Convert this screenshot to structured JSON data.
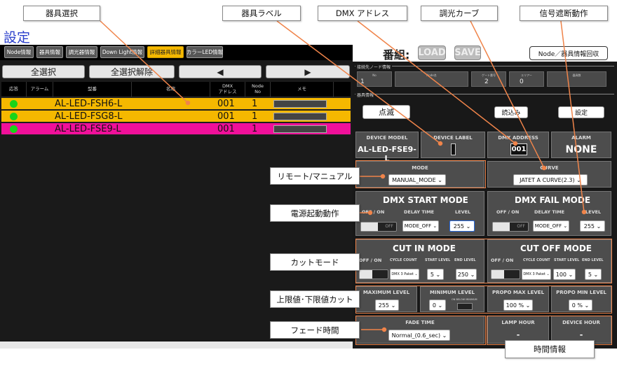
{
  "page_title": "設定",
  "tabs": [
    "Node情報",
    "器具情報",
    "調光器情報",
    "Down Light情報",
    "詳細器具情報",
    "カラーLED情報"
  ],
  "active_tab": "詳細器具情報",
  "left_toolbar": {
    "select_all": "全選択",
    "deselect_all": "全選択解除",
    "prev": "◀",
    "next": "▶"
  },
  "table": {
    "headers": [
      "応答",
      "アラーム",
      "型番",
      "名称",
      "DMX\nアドレス",
      "Node\nNo",
      "メモ"
    ],
    "rows": [
      {
        "model": "AL-LED-FSH6-L",
        "dmx": "001",
        "node": "1",
        "bg": "#f5b800"
      },
      {
        "model": "AL-LED-FSG8-L",
        "dmx": "001",
        "node": "1",
        "bg": "#f5b800"
      },
      {
        "model": "AL-LED-FSE9-L",
        "dmx": "001",
        "node": "1",
        "bg": "#f0109a"
      }
    ]
  },
  "program": {
    "label": "番組:",
    "load": "LOAD",
    "save": "SAVE",
    "node_collect": "Node／器具情報回収"
  },
  "conn_node": {
    "title": "接続先ノード情報",
    "fields": [
      {
        "label": "No",
        "value": "1"
      },
      {
        "label": "Node名",
        "value": ""
      },
      {
        "label": "ゲート番号",
        "value": "2"
      },
      {
        "label": "エリアー",
        "value": "0"
      },
      {
        "label": "器具数",
        "value": ""
      }
    ]
  },
  "fixture": {
    "title": "器具情報",
    "blink": "点滅",
    "read": "読込み",
    "set": "設定",
    "device_model_label": "DEVICE MODEL",
    "device_model": "AL-LED-FSE9-L",
    "device_label_label": "DEVICE LABEL",
    "dmx_address_label": "DMX ADDRESS",
    "dmx_address": "001",
    "alarm_label": "ALARM",
    "alarm": "NONE",
    "mode_label": "MODE",
    "mode": "MANUAL_MODE",
    "curve_label": "CURVE",
    "curve": "JATET A CURVE(2.3)",
    "dmx_start_title": "DMX START MODE",
    "dmx_fail_title": "DMX FAIL MODE",
    "off_on": "OFF / ON",
    "delay_time": "DELAY TIME",
    "level": "LEVEL",
    "start_delay": "MODE_OFF",
    "start_level": "255",
    "fail_delay": "MODE_OFF",
    "fail_level": "255",
    "off": "OFF",
    "cut_in_title": "CUT IN MODE",
    "cut_off_title": "CUT OFF MODE",
    "cycle_count": "CYCLE COUNT",
    "start_level_l": "START LEVEL",
    "end_level_l": "END LEVEL",
    "cutin_cycle": "DMX 3 Paket",
    "cutin_start": "5",
    "cutin_end": "250",
    "cutoff_cycle": "DMX 3 Paket",
    "cutoff_start": "100",
    "cutoff_end": "5",
    "max_level_l": "MAXIMUM LEVEL",
    "max_level": "255",
    "min_level_l": "MINIMUM LEVEL",
    "min_level": "0",
    "below_min": "ON BELOW MINIMUM",
    "propo_max_l": "PROPO MAX LEVEL",
    "propo_max": "100 %",
    "propo_min_l": "PROPO MIN LEVEL",
    "propo_min": "0 %",
    "fade_l": "FADE TIME",
    "fade": "Normal_(0.6_sec)",
    "lamp_hour_l": "LAMP HOUR",
    "lamp_hour": "-",
    "device_hour_l": "DEVICE HOUR",
    "device_hour": "-"
  },
  "annotations": {
    "fixture_select": "器具選択",
    "fixture_label": "器具ラベル",
    "dmx_address": "DMX アドレス",
    "dimming_curve": "調光カーブ",
    "signal_loss": "信号遮断動作",
    "remote_manual": "リモート/マニュアル",
    "power_on": "電源起動動作",
    "cut_mode": "カットモード",
    "limits": "上限値･下限値カット",
    "fade_time": "フェード時間",
    "time_info": "時間情報"
  },
  "colors": {
    "annotation_line": "#f0844a",
    "active_tab": "#f5b800",
    "row_magenta": "#f0109a",
    "led_green": "#19d419"
  }
}
